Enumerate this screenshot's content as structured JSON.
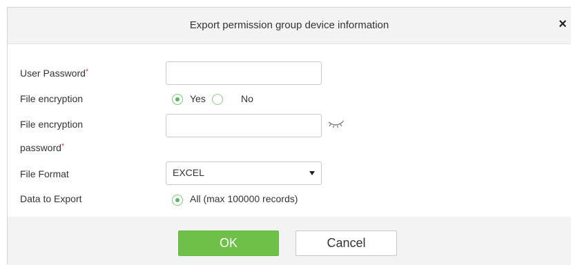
{
  "dialog": {
    "title": "Export permission group device information",
    "close_symbol": "×"
  },
  "form": {
    "user_password": {
      "label": "User Password",
      "required_mark": "*",
      "value": ""
    },
    "file_encryption": {
      "label": "File encryption",
      "options": [
        {
          "label": "Yes",
          "selected": true
        },
        {
          "label": "No",
          "selected": false
        }
      ]
    },
    "file_encryption_password": {
      "label_line1": "File encryption",
      "label_line2": "password",
      "required_mark": "*",
      "value": "",
      "toggle_icon": "eye-closed-icon"
    },
    "file_format": {
      "label": "File Format",
      "selected": "EXCEL"
    },
    "data_to_export": {
      "label": "Data to Export",
      "option": "All (max 100000 records)",
      "selected": true
    }
  },
  "footer": {
    "ok_label": "OK",
    "cancel_label": "Cancel"
  },
  "colors": {
    "accent_green": "#6ec048",
    "required_red": "#e03b3b",
    "dialog_bg": "#f3f3f3"
  }
}
